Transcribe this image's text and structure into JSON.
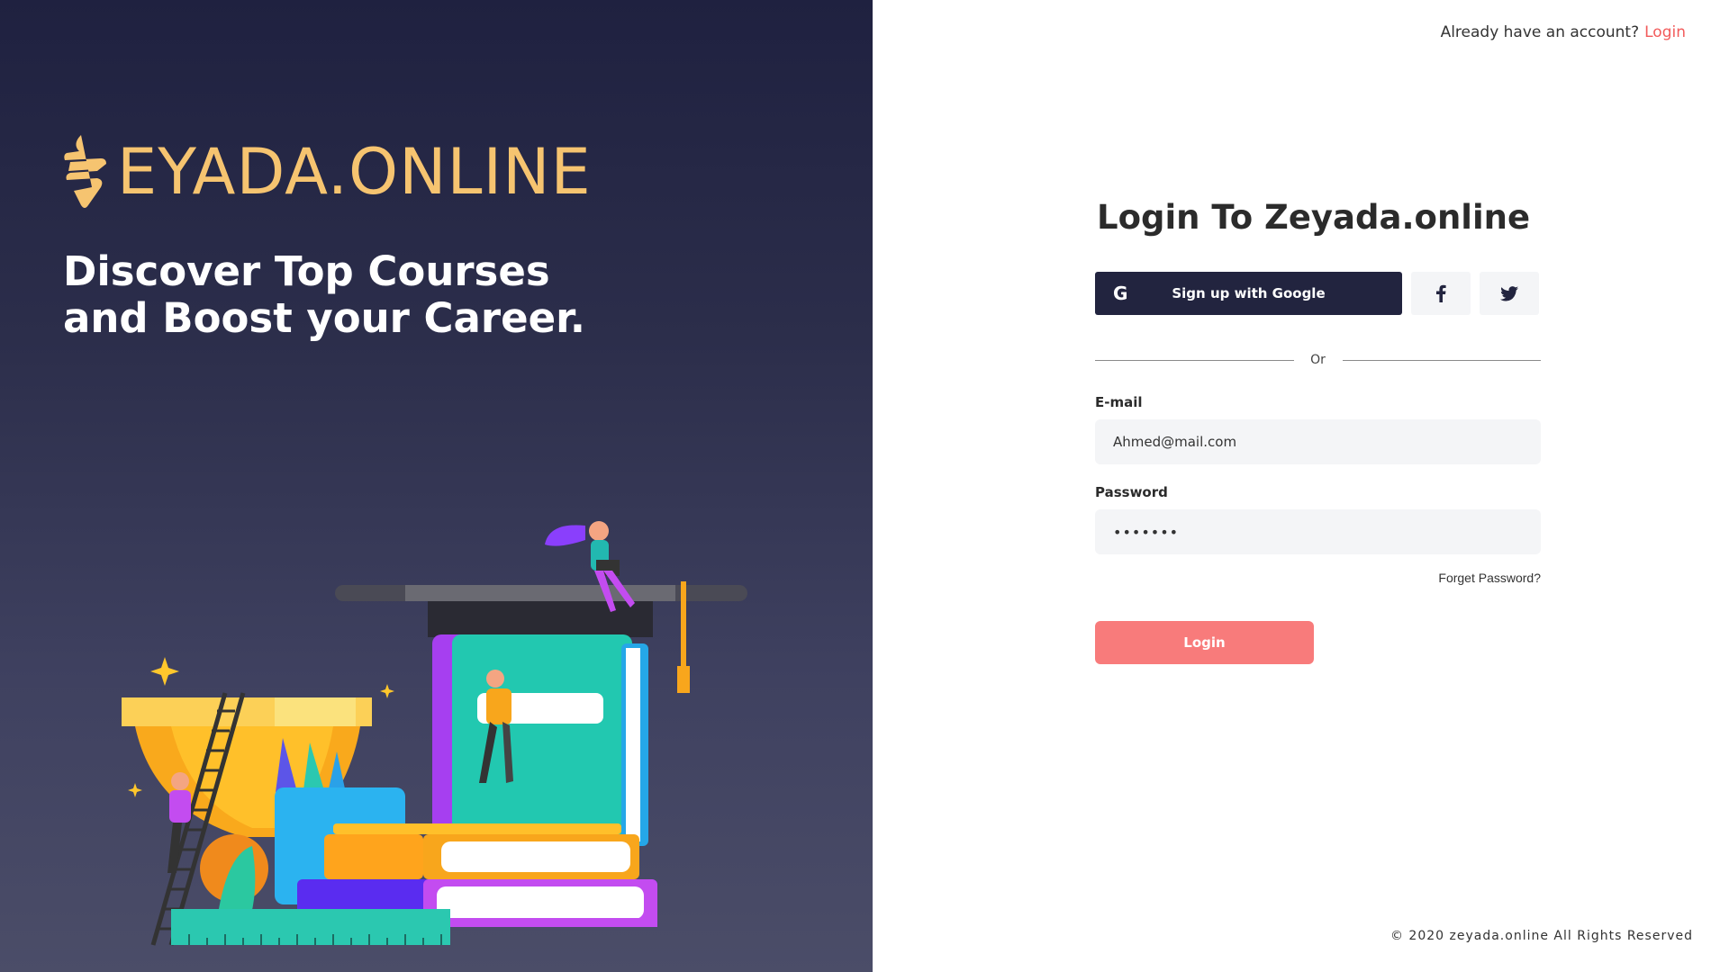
{
  "brand": {
    "logo_text": "EYADA.ONLINE",
    "headline_line1": "Discover Top Courses",
    "headline_line2": "and Boost your Career."
  },
  "header": {
    "prompt_text": "Already have an account?",
    "login_link": "Login"
  },
  "form": {
    "title": "Login To Zeyada.online",
    "google_icon": "G",
    "google_label": "Sign up with Google",
    "facebook_icon": "facebook-icon",
    "twitter_icon": "twitter-icon",
    "divider_text": "Or",
    "email_label": "E-mail",
    "email_value": "Ahmed@mail.com",
    "password_label": "Password",
    "password_value": "•••••••",
    "forget_password": "Forget Password?",
    "login_button": "Login"
  },
  "footer": {
    "copyright": "© 2020 zeyada.online All Rights Reserved"
  },
  "colors": {
    "left_bg_top": "#1f2140",
    "left_bg_bottom": "#4b4d68",
    "brand_yellow": "#f6c470",
    "google_btn": "#22243f",
    "accent_red": "#f25b5b",
    "login_btn": "#f87b7b"
  }
}
